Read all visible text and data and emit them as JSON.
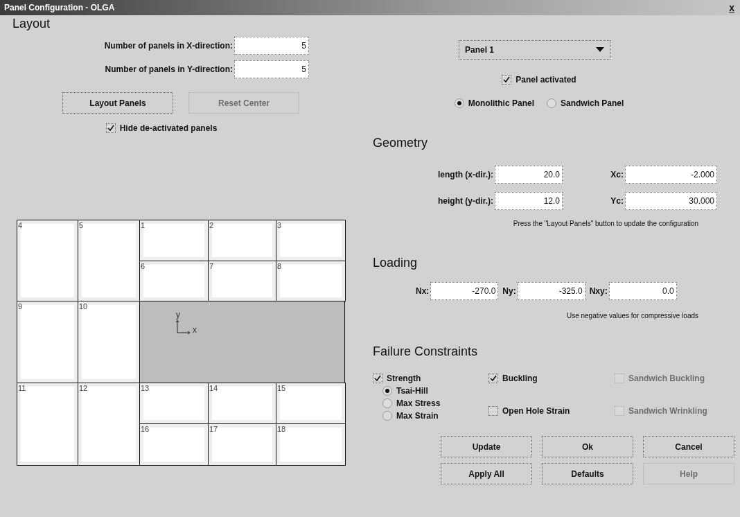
{
  "window": {
    "title": "Panel Configuration - OLGA",
    "close": "x"
  },
  "layout": {
    "heading": "Layout",
    "fields": [
      {
        "label": "Number of panels in X-direction:",
        "value": "5"
      },
      {
        "label": "Number of panels in Y-direction:",
        "value": "5"
      }
    ],
    "buttons": [
      {
        "label": "Layout Panels",
        "disabled": false
      },
      {
        "label": "Reset Center",
        "disabled": true
      }
    ],
    "hide_deactivated": {
      "label": "Hide de-activated panels",
      "checked": true
    },
    "panels": [
      "4",
      "5",
      "1",
      "2",
      "3",
      "6",
      "7",
      "8",
      "9",
      "10",
      "11",
      "12",
      "13",
      "14",
      "15",
      "16",
      "17",
      "18"
    ],
    "axes": {
      "y": "y",
      "x": "x"
    }
  },
  "panel_select": {
    "value": "Panel 1"
  },
  "panel_activated": {
    "label": "Panel activated",
    "checked": true
  },
  "panel_type": [
    {
      "label": "Monolithic Panel",
      "selected": true
    },
    {
      "label": "Sandwich Panel",
      "selected": false
    }
  ],
  "geometry": {
    "heading": "Geometry",
    "fields": [
      {
        "label": "length (x-dir.):",
        "value": "20.0"
      },
      {
        "label": "Xc:",
        "value": "-2.000"
      },
      {
        "label": "height (y-dir.):",
        "value": "12.0"
      },
      {
        "label": "Yc:",
        "value": "30.000"
      }
    ],
    "note": "Press the \"Layout Panels\" button to update the configuration"
  },
  "loading": {
    "heading": "Loading",
    "fields": [
      {
        "label": "Nx:",
        "value": "-270.0"
      },
      {
        "label": "Ny:",
        "value": "-325.0"
      },
      {
        "label": "Nxy:",
        "value": "0.0"
      }
    ],
    "note": "Use negative values for compressive loads"
  },
  "failure": {
    "heading": "Failure Constraints",
    "strength": {
      "label": "Strength",
      "checked": true
    },
    "criteria": [
      {
        "label": "Tsai-Hill",
        "selected": true
      },
      {
        "label": "Max Stress",
        "selected": false
      },
      {
        "label": "Max Strain",
        "selected": false
      }
    ],
    "buckling": [
      {
        "label": "Buckling",
        "checked": true,
        "disabled": false
      },
      {
        "label": "Open Hole Strain",
        "checked": false,
        "disabled": false
      }
    ],
    "sandwich": [
      {
        "label": "Sandwich Buckling",
        "checked": false,
        "disabled": true
      },
      {
        "label": "Sandwich Wrinkling",
        "checked": false,
        "disabled": true
      }
    ]
  },
  "buttons": [
    {
      "label": "Update",
      "disabled": false
    },
    {
      "label": "Ok",
      "disabled": false
    },
    {
      "label": "Cancel",
      "disabled": false
    },
    {
      "label": "Apply All",
      "disabled": false
    },
    {
      "label": "Defaults",
      "disabled": false
    },
    {
      "label": "Help",
      "disabled": true
    }
  ]
}
